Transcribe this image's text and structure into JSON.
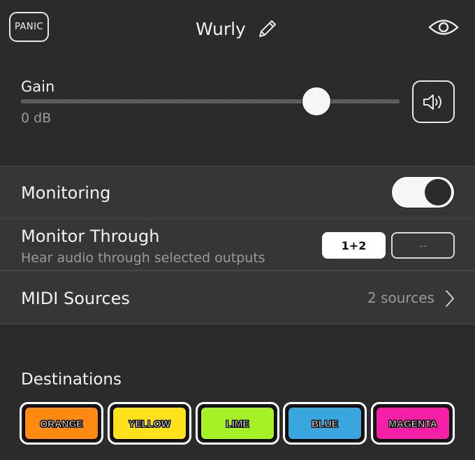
{
  "header": {
    "panic_label": "PANIC",
    "title": "Wurly"
  },
  "gain": {
    "label": "Gain",
    "value_text": "0 dB",
    "slider_fraction": 0.78
  },
  "monitoring": {
    "label": "Monitoring",
    "enabled": true
  },
  "monitor_through": {
    "label": "Monitor Through",
    "subtitle": "Hear audio through selected outputs",
    "outputs": [
      "1+2",
      "--"
    ],
    "selected": "1+2"
  },
  "midi_sources": {
    "label": "MIDI Sources",
    "count_text": "2 sources"
  },
  "destinations": {
    "label": "Destinations",
    "items": [
      {
        "label": "ORANGE",
        "color": "#ff8a12"
      },
      {
        "label": "YELLOW",
        "color": "#ffe21a"
      },
      {
        "label": "LIME",
        "color": "#a6f026"
      },
      {
        "label": "BLUE",
        "color": "#3aa6e0"
      },
      {
        "label": "MAGENTA",
        "color": "#f51fa8"
      }
    ]
  },
  "icons": {
    "pencil": "pencil-icon",
    "eye": "eye-icon",
    "speaker": "speaker-icon",
    "chevron": "chevron-right-icon"
  }
}
